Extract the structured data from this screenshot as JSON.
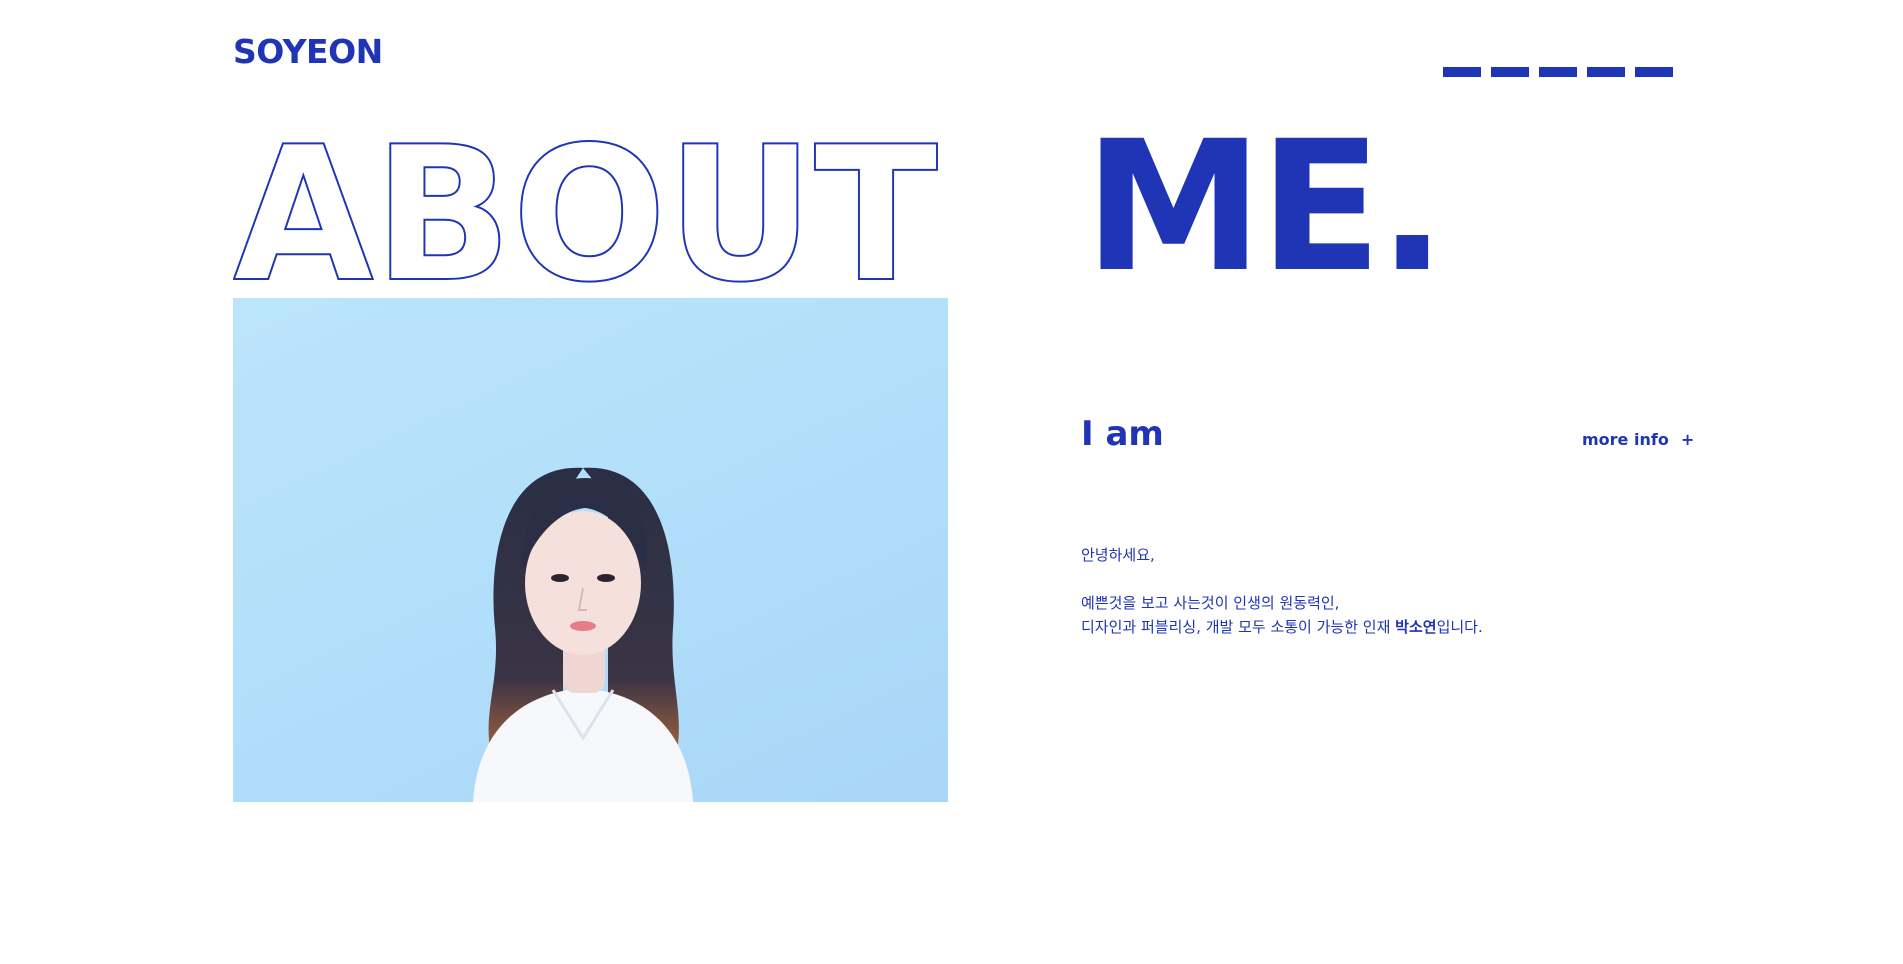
{
  "header": {
    "logo": "SOYEON",
    "menu_icon": "hamburger-dashes-icon",
    "menu_dash_count": 5
  },
  "hero": {
    "outline_word": "ABOUT",
    "solid_word": "ME."
  },
  "photo": {
    "alt": "portrait-photo"
  },
  "intro": {
    "heading": "I am",
    "more_info_label": "more info",
    "more_info_icon": "+",
    "greeting": "안녕하세요,",
    "line1": "예쁜것을 보고 사는것이 인생의 원동력인,",
    "line2_prefix": "디자인과 퍼블리싱, 개발 모두 소통이 가능한 인재 ",
    "line2_name": "박소연",
    "line2_suffix": "입니다."
  },
  "colors": {
    "accent": "#1f35b5",
    "background": "#ffffff",
    "photo_bg": "#b3e0fa"
  }
}
